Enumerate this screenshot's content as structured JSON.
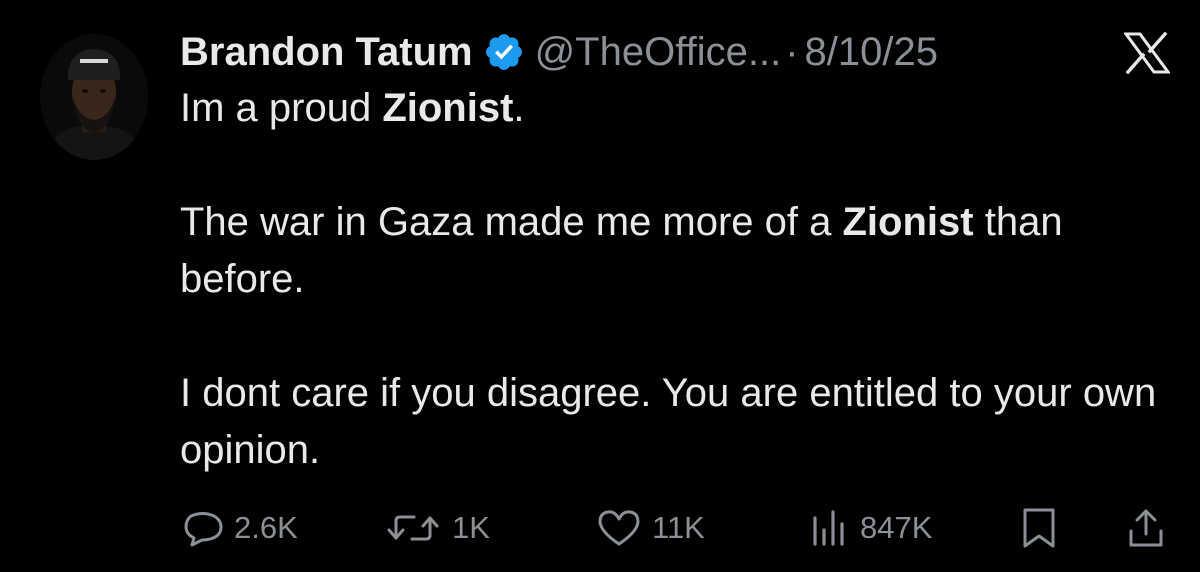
{
  "tweet": {
    "author_name": "Brandon Tatum",
    "handle": "@TheOffice...",
    "separator": "·",
    "date": "8/10/25",
    "lines": [
      {
        "parts": [
          "Im a proud ",
          "Zionist",
          "."
        ]
      },
      {
        "parts": [
          "The war in Gaza made me more of a ",
          "Zionist",
          " than before."
        ]
      },
      {
        "parts": [
          "I dont care if you disagree. You are entitled to your own opinion."
        ]
      }
    ]
  },
  "actions": {
    "replies": "2.6K",
    "reposts": "1K",
    "likes": "11K",
    "views": "847K"
  },
  "colors": {
    "background": "#000000",
    "text": "#e7e9ea",
    "muted": "#8b9096",
    "verified": "#1d9bf0"
  },
  "icons": [
    "verified-badge-icon",
    "x-logo-icon",
    "reply-icon",
    "repost-icon",
    "like-icon",
    "views-icon",
    "bookmark-icon",
    "share-icon"
  ]
}
